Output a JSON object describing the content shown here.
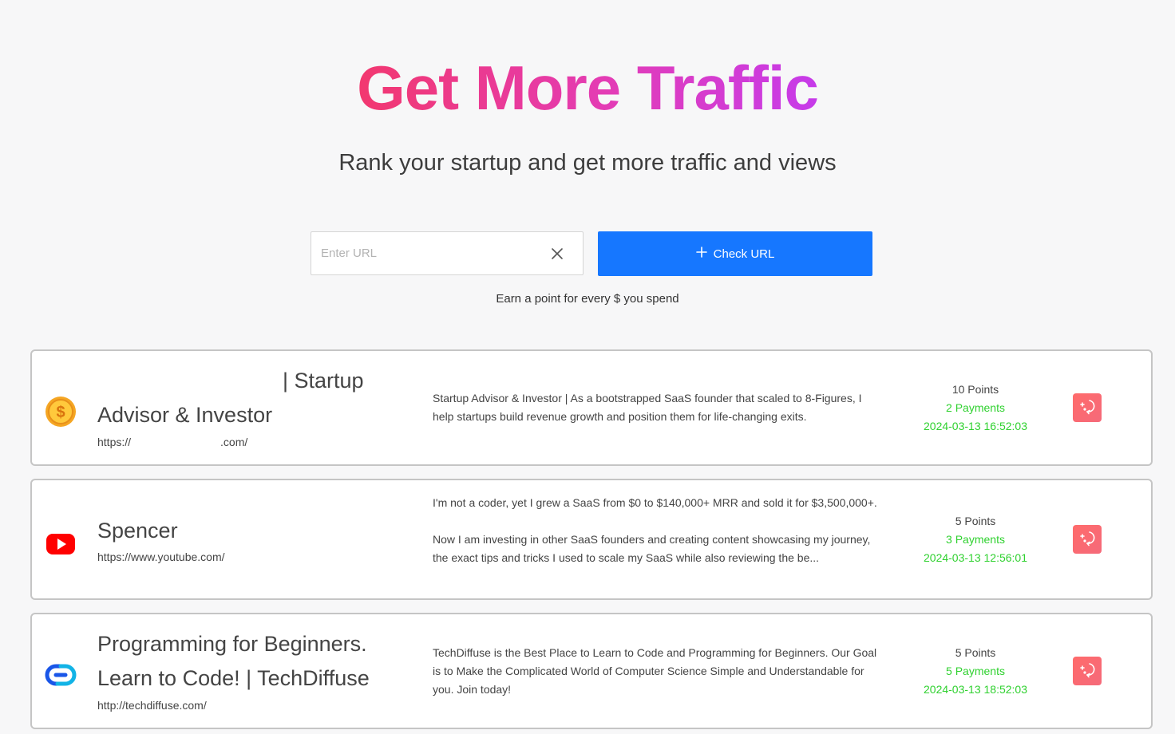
{
  "hero": {
    "title": "Get More Traffic",
    "subtitle": "Rank your startup and get more traffic and views"
  },
  "form": {
    "url_placeholder": "Enter URL",
    "url_value": "",
    "check_button_label": "Check URL",
    "note": "Earn a point for every $ you spend"
  },
  "listings": [
    {
      "icon": "dollar-coin-icon",
      "title_line1": "| Startup",
      "title_line2": "Advisor & Investor",
      "url_prefix": "https://",
      "url_suffix": ".com/",
      "description": [
        "Startup Advisor & Investor | As a bootstrapped SaaS founder that scaled to 8-Figures, I help startups build revenue growth and position them for life-changing exits."
      ],
      "points": "10 Points",
      "payments": "2 Payments",
      "date": "2024-03-13 16:52:03"
    },
    {
      "icon": "youtube-icon",
      "title_line1": "Spencer",
      "url": "https://www.youtube.com/",
      "description": [
        "I'm not a coder, yet I grew a SaaS from $0 to $140,000+ MRR and sold it for $3,500,000+.",
        "Now I am investing in other SaaS founders and creating content showcasing my journey, the exact tips and tricks I used to scale my SaaS while also reviewing the be..."
      ],
      "points": "5 Points",
      "payments": "3 Payments",
      "date": "2024-03-13 12:56:01"
    },
    {
      "icon": "techdiffuse-logo-icon",
      "title_line1": "Programming for Beginners.",
      "title_line2": "Learn to Code! | TechDiffuse",
      "url": "http://techdiffuse.com/",
      "description": [
        "TechDiffuse is the Best Place to Learn to Code and Programming for Beginners. Our Goal is to Make the Complicated World of Computer Science Simple and Understandable for you. Join today!"
      ],
      "points": "5 Points",
      "payments": "5 Payments",
      "date": "2024-03-13 18:52:03"
    }
  ],
  "colors": {
    "accent_blue": "#1677ff",
    "title_gradient_start": "#f2386f",
    "title_gradient_end": "#c63bea",
    "status_green": "#2fd12f",
    "boost_red": "#ff6b6b"
  }
}
